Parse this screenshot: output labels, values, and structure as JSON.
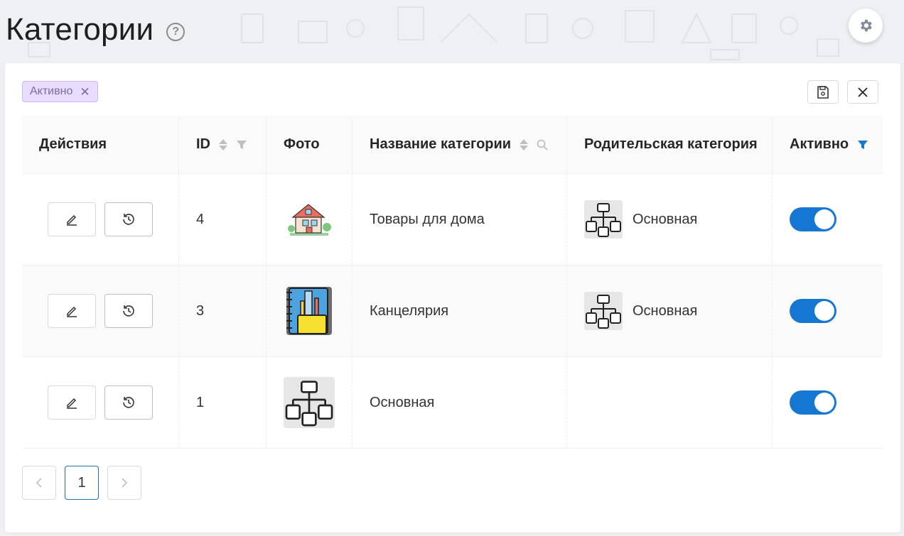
{
  "page": {
    "title": "Категории"
  },
  "filter_tag": {
    "label": "Активно"
  },
  "table": {
    "columns": {
      "actions": "Действия",
      "id": "ID",
      "photo": "Фото",
      "name": "Название категории",
      "parent": "Родительская категория",
      "active": "Активно"
    },
    "rows": [
      {
        "id": "4",
        "name": "Товары для дома",
        "parent": "Основная",
        "photo": "house-icon",
        "active": true
      },
      {
        "id": "3",
        "name": "Канцелярия",
        "parent": "Основная",
        "photo": "stationery-icon",
        "active": true
      },
      {
        "id": "1",
        "name": "Основная",
        "parent": "",
        "photo": "hierarchy-icon",
        "active": true
      }
    ]
  },
  "pagination": {
    "current_page": "1"
  },
  "colors": {
    "accent": "#1677d2",
    "tag_bg": "#e8dcff",
    "tag_text": "#7a6aa8"
  }
}
